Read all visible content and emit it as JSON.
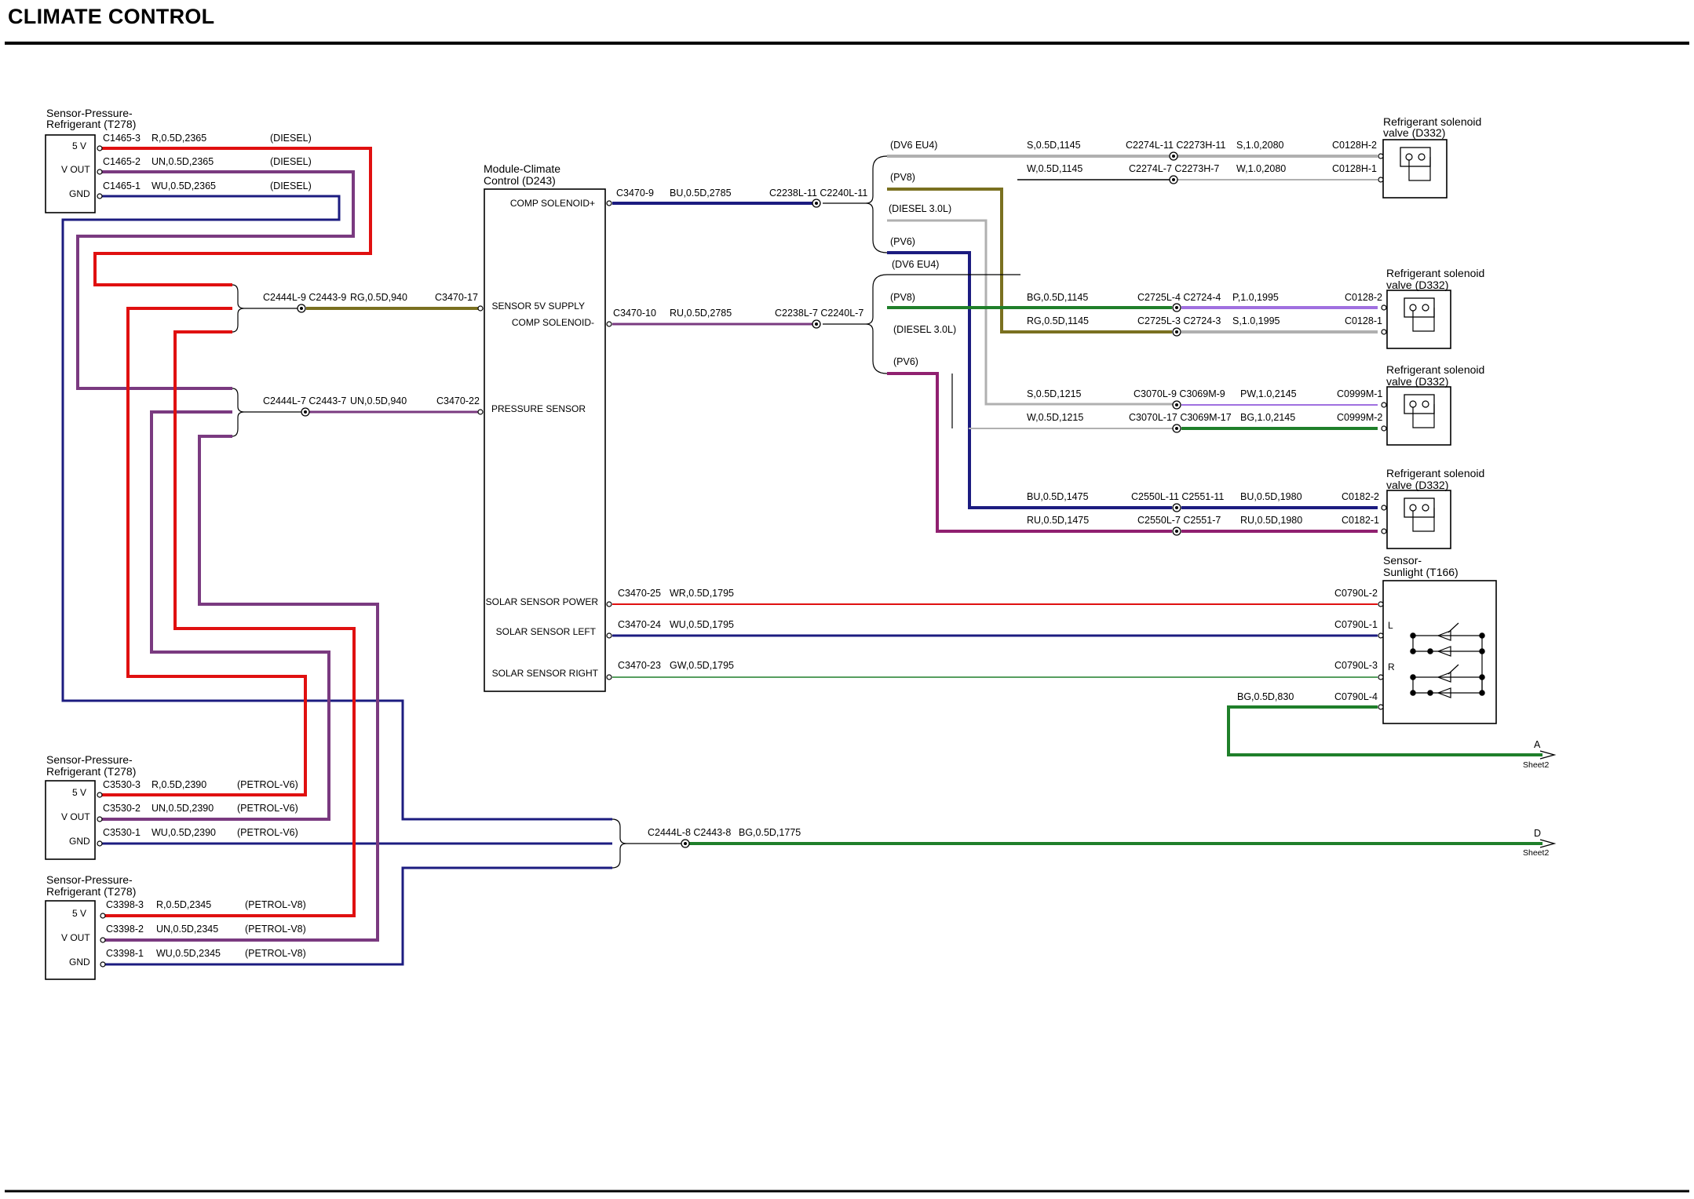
{
  "title": "CLIMATE CONTROL",
  "colors": {
    "red": "#e01010",
    "purple": "#7a3a80",
    "navy": "#1c1c80",
    "olive": "#7a7020",
    "green": "#1f7f2a",
    "grey": "#b0b0b0",
    "brown": "#8a5a10",
    "violet": "#a070e0",
    "magenta": "#902070"
  },
  "module": {
    "name1": "Module-Climate",
    "name2": "Control (D243)",
    "pins": [
      "COMP SOLENOID+",
      "SENSOR 5V SUPPLY",
      "COMP SOLENOID-",
      "PRESSURE SENSOR",
      "SOLAR SENSOR POWER",
      "SOLAR SENSOR LEFT",
      "SOLAR SENSOR RIGHT"
    ]
  },
  "sensors": {
    "s1": {
      "name1": "Sensor-Pressure-",
      "name2": "Refrigerant (T278)",
      "pins": [
        "5 V",
        "V OUT",
        "GND"
      ],
      "wires": [
        {
          "c": "C1465-3",
          "w": "R,0.5D,2365",
          "v": "(DIESEL)"
        },
        {
          "c": "C1465-2",
          "w": "UN,0.5D,2365",
          "v": "(DIESEL)"
        },
        {
          "c": "C1465-1",
          "w": "WU,0.5D,2365",
          "v": "(DIESEL)"
        }
      ]
    },
    "s2": {
      "name1": "Sensor-Pressure-",
      "name2": "Refrigerant (T278)",
      "pins": [
        "5 V",
        "V OUT",
        "GND"
      ],
      "wires": [
        {
          "c": "C3530-3",
          "w": "R,0.5D,2390",
          "v": "(PETROL-V6)"
        },
        {
          "c": "C3530-2",
          "w": "UN,0.5D,2390",
          "v": "(PETROL-V6)"
        },
        {
          "c": "C3530-1",
          "w": "WU,0.5D,2390",
          "v": "(PETROL-V6)"
        }
      ]
    },
    "s3": {
      "name1": "Sensor-Pressure-",
      "name2": "Refrigerant (T278)",
      "pins": [
        "5 V",
        "V OUT",
        "GND"
      ],
      "wires": [
        {
          "c": "C3398-3",
          "w": "R,0.5D,2345",
          "v": "(PETROL-V8)"
        },
        {
          "c": "C3398-2",
          "w": "UN,0.5D,2345",
          "v": "(PETROL-V8)"
        },
        {
          "c": "C3398-1",
          "w": "WU,0.5D,2345",
          "v": "(PETROL-V8)"
        }
      ]
    }
  },
  "splices": {
    "sp1": {
      "c": "C2444L-9 C2443-9",
      "w": "RG,0.5D,940",
      "p": "C3470-17"
    },
    "sp2": {
      "c": "C2444L-7 C2443-7",
      "w": "UN,0.5D,940",
      "p": "C3470-22"
    },
    "sp3": {
      "c": "C2444L-8 C2443-8",
      "w": "BG,0.5D,1775"
    }
  },
  "module_out": {
    "o1": {
      "p": "C3470-9",
      "w": "BU,0.5D,2785",
      "c": "C2238L-11 C2240L-11"
    },
    "o2": {
      "p": "C3470-10",
      "w": "RU,0.5D,2785",
      "c": "C2238L-7 C2240L-7"
    },
    "o3": {
      "p": "C3470-25",
      "w": "WR,0.5D,1795",
      "t": "C0790L-2"
    },
    "o4": {
      "p": "C3470-24",
      "w": "WU,0.5D,1795",
      "t": "C0790L-1"
    },
    "o5": {
      "p": "C3470-23",
      "w": "GW,0.5D,1795",
      "t": "C0790L-3"
    }
  },
  "variants": {
    "a": [
      "(DV6 EU4)",
      "(PV8)",
      "(DIESEL 3.0L)",
      "(PV6)"
    ],
    "b": [
      "(DV6 EU4)",
      "(PV8)",
      "(DIESEL 3.0L)",
      "(PV6)"
    ]
  },
  "valves": {
    "v1": {
      "name1": "Refrigerant solenoid",
      "name2": "valve (D332)",
      "r1": {
        "w1": "S,0.5D,1145",
        "c": "C2274L-11 C2273H-11",
        "w2": "S,1.0,2080",
        "p": "C0128H-2"
      },
      "r2": {
        "w1": "W,0.5D,1145",
        "c": "C2274L-7 C2273H-7",
        "w2": "W,1.0,2080",
        "p": "C0128H-1"
      }
    },
    "v2": {
      "name1": "Refrigerant solenoid",
      "name2": "valve (D332)",
      "r1": {
        "w1": "BG,0.5D,1145",
        "c": "C2725L-4 C2724-4",
        "w2": "P,1.0,1995",
        "p": "C0128-2"
      },
      "r2": {
        "w1": "RG,0.5D,1145",
        "c": "C2725L-3 C2724-3",
        "w2": "S,1.0,1995",
        "p": "C0128-1"
      }
    },
    "v3": {
      "name1": "Refrigerant solenoid",
      "name2": "valve (D332)",
      "r1": {
        "w1": "S,0.5D,1215",
        "c": "C3070L-9 C3069M-9",
        "w2": "PW,1.0,2145",
        "p": "C0999M-1"
      },
      "r2": {
        "w1": "W,0.5D,1215",
        "c": "C3070L-17 C3069M-17",
        "w2": "BG,1.0,2145",
        "p": "C0999M-2"
      }
    },
    "v4": {
      "name1": "Refrigerant solenoid",
      "name2": "valve (D332)",
      "r1": {
        "w1": "BU,0.5D,1475",
        "c": "C2550L-11 C2551-11",
        "w2": "BU,0.5D,1980",
        "p": "C0182-2"
      },
      "r2": {
        "w1": "RU,0.5D,1475",
        "c": "C2550L-7 C2551-7",
        "w2": "RU,0.5D,1980",
        "p": "C0182-1"
      }
    }
  },
  "sunlight": {
    "name1": "Sensor-",
    "name2": "Sunlight (T166)",
    "L": "L",
    "R": "R",
    "gw": "BG,0.5D,830",
    "gp": "C0790L-4"
  },
  "sheet_refs": {
    "a": "A",
    "d": "D",
    "sheet": "Sheet2"
  }
}
